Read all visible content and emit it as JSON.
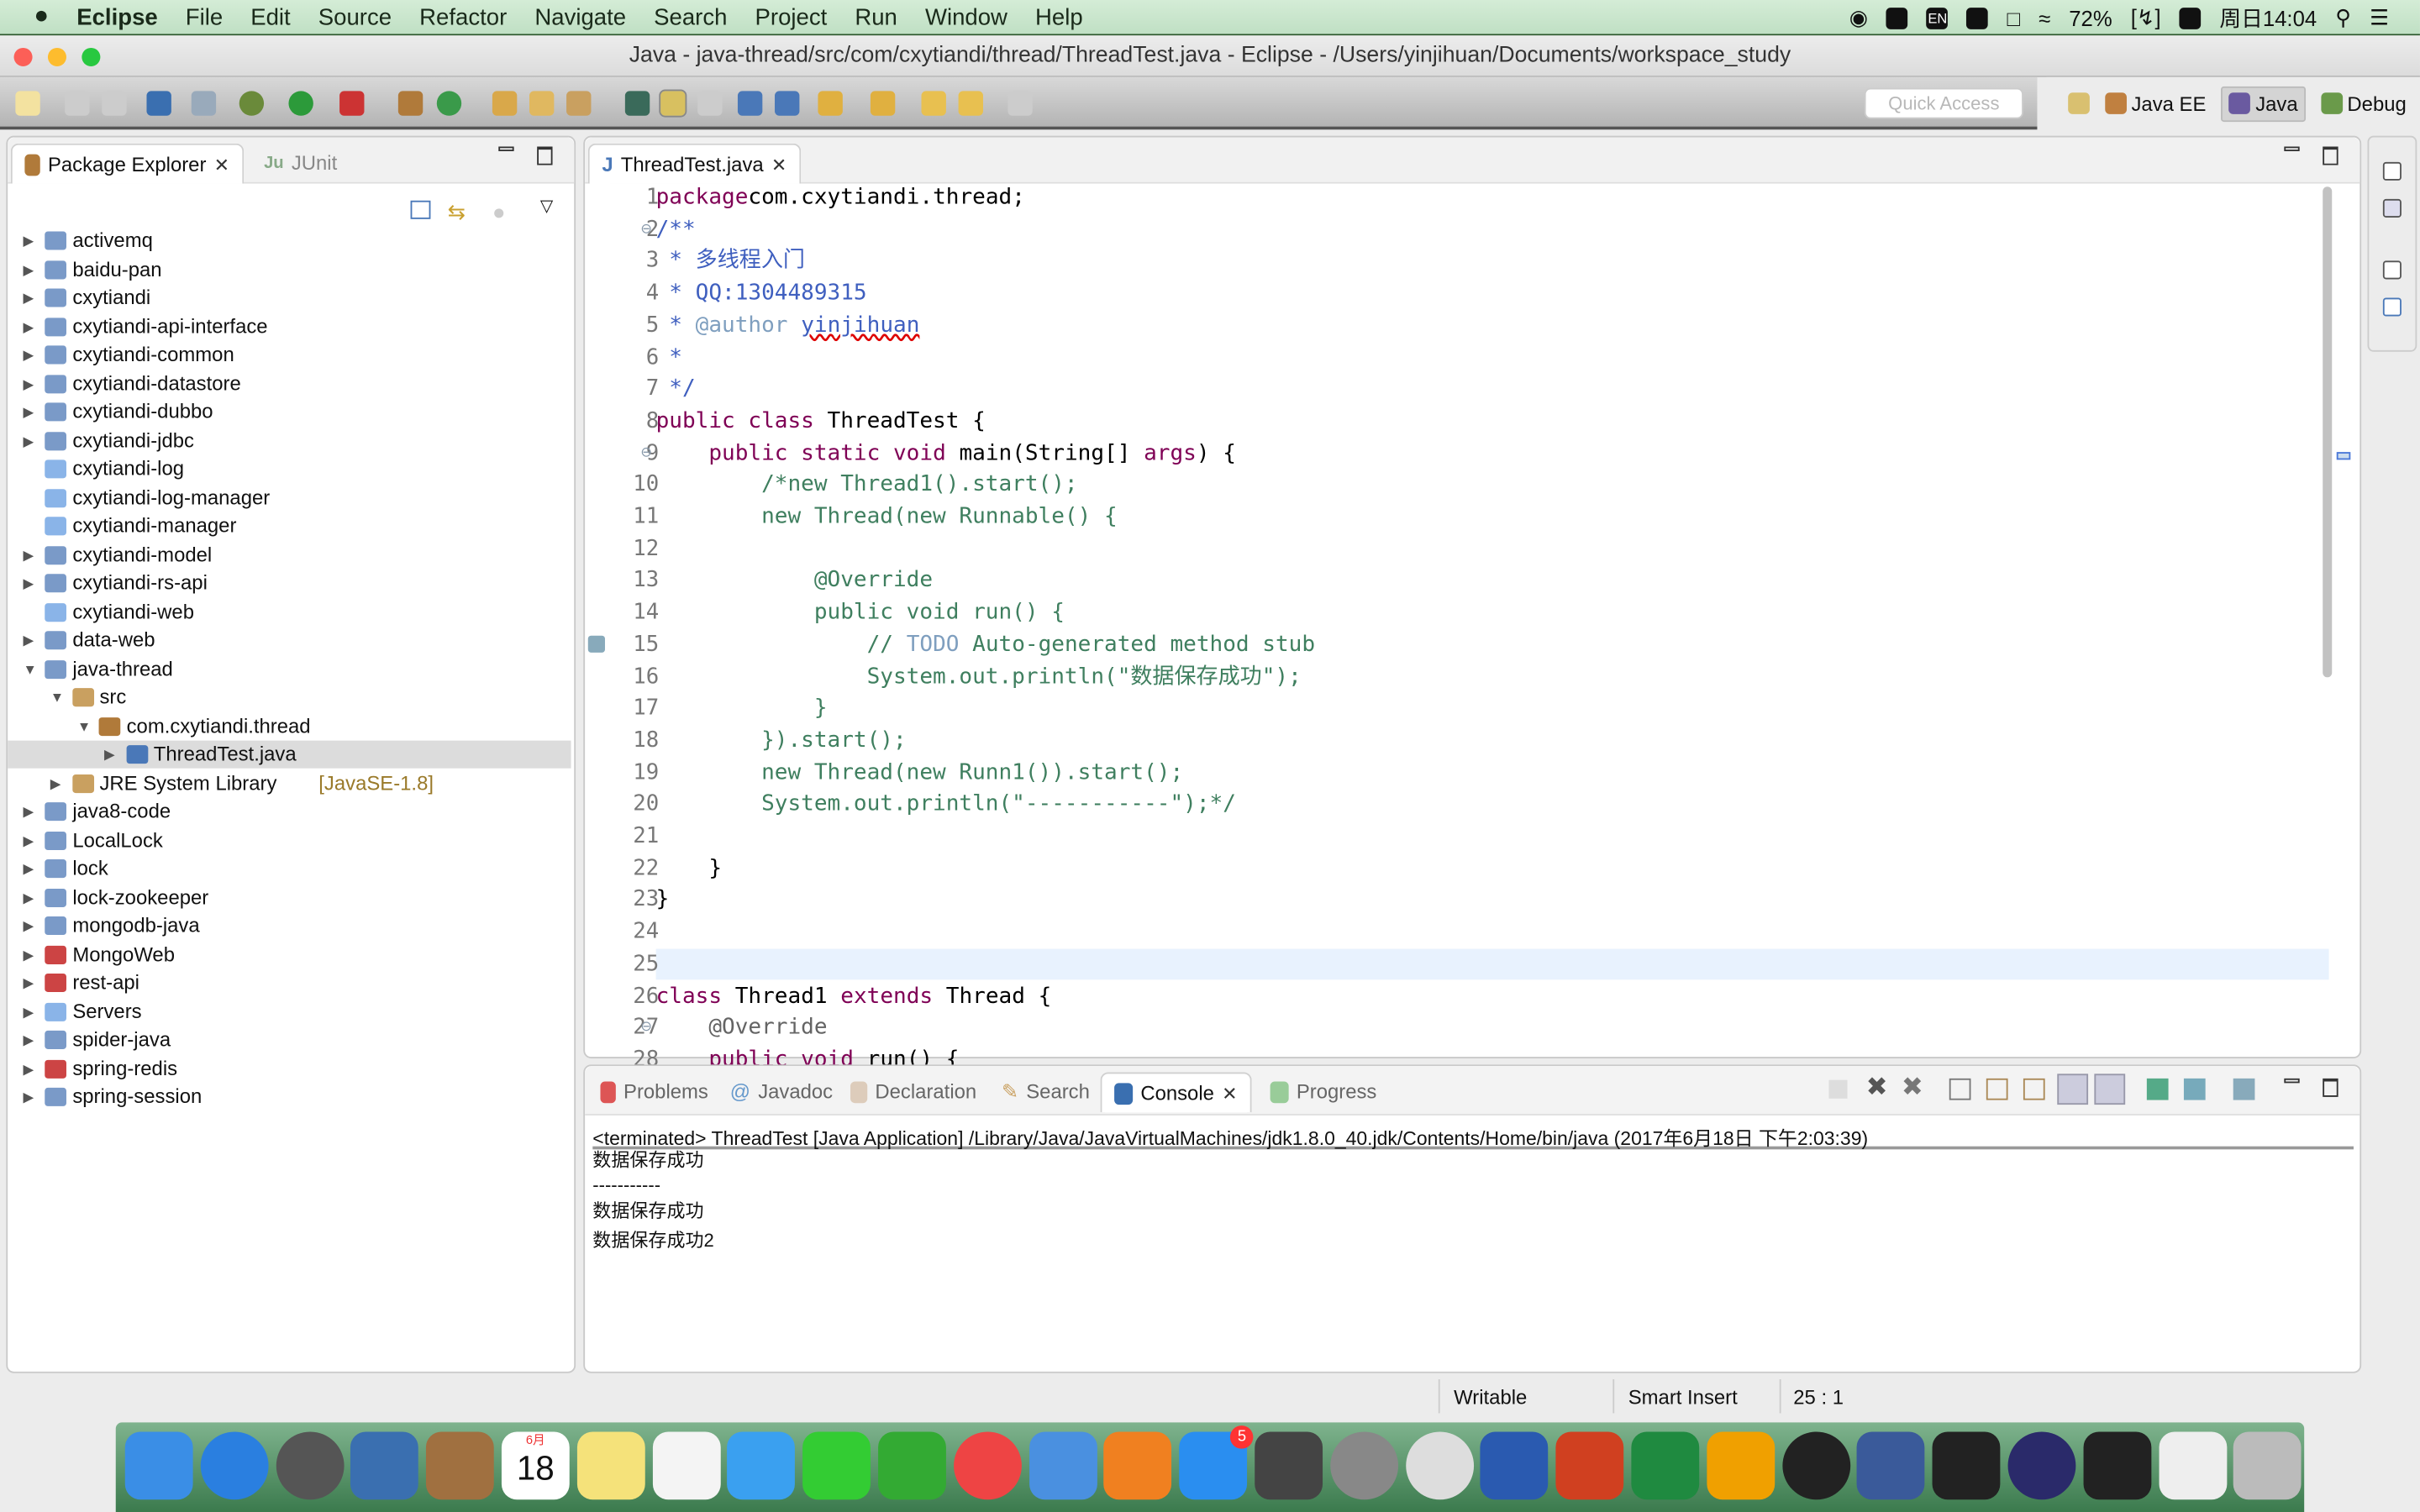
{
  "menubar": {
    "app": "Eclipse",
    "items": [
      "File",
      "Edit",
      "Source",
      "Refactor",
      "Navigate",
      "Search",
      "Project",
      "Run",
      "Window",
      "Help"
    ],
    "battery": "72%",
    "clock": "周日14:04",
    "input": "EN"
  },
  "window": {
    "title": "Java - java-thread/src/com/cxytiandi/thread/ThreadTest.java - Eclipse - /Users/yinjihuan/Documents/workspace_study"
  },
  "toolbar": {
    "quick_access_placeholder": "Quick Access",
    "perspectives": [
      {
        "label": "Java EE",
        "active": false
      },
      {
        "label": "Java",
        "active": true
      },
      {
        "label": "Debug",
        "active": false
      }
    ]
  },
  "explorer": {
    "tabs": [
      {
        "label": "Package Explorer",
        "active": true
      },
      {
        "label": "JUnit",
        "active": false
      }
    ],
    "items": [
      {
        "label": "activemq",
        "level": 0,
        "arrow": "right",
        "icon": "project"
      },
      {
        "label": "baidu-pan",
        "level": 0,
        "arrow": "right",
        "icon": "project"
      },
      {
        "label": "cxytiandi",
        "level": 0,
        "arrow": "right",
        "icon": "project"
      },
      {
        "label": "cxytiandi-api-interface",
        "level": 0,
        "arrow": "right",
        "icon": "project"
      },
      {
        "label": "cxytiandi-common",
        "level": 0,
        "arrow": "right",
        "icon": "project"
      },
      {
        "label": "cxytiandi-datastore",
        "level": 0,
        "arrow": "right",
        "icon": "project"
      },
      {
        "label": "cxytiandi-dubbo",
        "level": 0,
        "arrow": "right",
        "icon": "project"
      },
      {
        "label": "cxytiandi-jdbc",
        "level": 0,
        "arrow": "right",
        "icon": "project"
      },
      {
        "label": "cxytiandi-log",
        "level": 0,
        "arrow": "",
        "icon": "folder"
      },
      {
        "label": "cxytiandi-log-manager",
        "level": 0,
        "arrow": "",
        "icon": "folder"
      },
      {
        "label": "cxytiandi-manager",
        "level": 0,
        "arrow": "",
        "icon": "folder"
      },
      {
        "label": "cxytiandi-model",
        "level": 0,
        "arrow": "right",
        "icon": "project"
      },
      {
        "label": "cxytiandi-rs-api",
        "level": 0,
        "arrow": "right",
        "icon": "project"
      },
      {
        "label": "cxytiandi-web",
        "level": 0,
        "arrow": "",
        "icon": "folder"
      },
      {
        "label": "data-web",
        "level": 0,
        "arrow": "right",
        "icon": "project"
      },
      {
        "label": "java-thread",
        "level": 0,
        "arrow": "down",
        "icon": "project-open"
      },
      {
        "label": "src",
        "level": 1,
        "arrow": "down",
        "icon": "source-folder"
      },
      {
        "label": "com.cxytiandi.thread",
        "level": 2,
        "arrow": "down",
        "icon": "package"
      },
      {
        "label": "ThreadTest.java",
        "level": 3,
        "arrow": "right",
        "icon": "java-file",
        "selected": true
      },
      {
        "label": "JRE System Library",
        "decoration": "[JavaSE-1.8]",
        "level": 1,
        "arrow": "right",
        "icon": "library"
      },
      {
        "label": "java8-code",
        "level": 0,
        "arrow": "right",
        "icon": "project"
      },
      {
        "label": "LocalLock",
        "level": 0,
        "arrow": "right",
        "icon": "project"
      },
      {
        "label": "lock",
        "level": 0,
        "arrow": "right",
        "icon": "project"
      },
      {
        "label": "lock-zookeeper",
        "level": 0,
        "arrow": "right",
        "icon": "project"
      },
      {
        "label": "mongodb-java",
        "level": 0,
        "arrow": "right",
        "icon": "project"
      },
      {
        "label": "MongoWeb",
        "level": 0,
        "arrow": "right",
        "icon": "project-error"
      },
      {
        "label": "rest-api",
        "level": 0,
        "arrow": "right",
        "icon": "project-error"
      },
      {
        "label": "Servers",
        "level": 0,
        "arrow": "right",
        "icon": "folder-open"
      },
      {
        "label": "spider-java",
        "level": 0,
        "arrow": "right",
        "icon": "project"
      },
      {
        "label": "spring-redis",
        "level": 0,
        "arrow": "right",
        "icon": "project-error"
      },
      {
        "label": "spring-session",
        "level": 0,
        "arrow": "right",
        "icon": "project"
      }
    ]
  },
  "editor": {
    "tab": "ThreadTest.java",
    "current_line": 25,
    "lines": [
      [
        [
          "kw",
          "package"
        ],
        [
          "",
          "com.cxytiandi.thread;"
        ]
      ],
      [
        [
          "jd",
          "/**"
        ]
      ],
      [
        [
          "jd",
          " * 多线程入门"
        ]
      ],
      [
        [
          "jd",
          " * QQ:1304489315"
        ]
      ],
      [
        [
          "jd",
          " * "
        ],
        [
          "jt",
          "@author"
        ],
        [
          "jd",
          " "
        ],
        [
          "jd sp",
          "yinjihuan"
        ]
      ],
      [
        [
          "jd",
          " *"
        ]
      ],
      [
        [
          "jd",
          " */"
        ]
      ],
      [
        [
          "kw",
          "public class"
        ],
        [
          "",
          " ThreadTest {"
        ]
      ],
      [
        [
          "",
          "    "
        ],
        [
          "kw",
          "public static void"
        ],
        [
          "",
          " main(String[] "
        ],
        [
          "kw",
          "args"
        ],
        [
          "",
          ") {"
        ]
      ],
      [
        [
          "cm",
          "        /*new Thread1().start();"
        ]
      ],
      [
        [
          "cm",
          "        new Thread(new Runnable() {"
        ]
      ],
      [
        [
          "cm",
          ""
        ]
      ],
      [
        [
          "cm",
          "            @Override"
        ]
      ],
      [
        [
          "cm",
          "            public void run() {"
        ]
      ],
      [
        [
          "cm",
          "                // "
        ],
        [
          "todo",
          "TODO"
        ],
        [
          "cm",
          " Auto-generated method stub"
        ]
      ],
      [
        [
          "cm",
          "                System.out.println(\"数据保存成功\");"
        ]
      ],
      [
        [
          "cm",
          "            }"
        ]
      ],
      [
        [
          "cm",
          "        }).start();"
        ]
      ],
      [
        [
          "cm",
          "        new Thread(new Runn1()).start();"
        ]
      ],
      [
        [
          "cm",
          "        System.out.println(\"-----------\");*/"
        ]
      ],
      [
        [
          "",
          ""
        ]
      ],
      [
        [
          "",
          "    }"
        ]
      ],
      [
        [
          "",
          "}"
        ]
      ],
      [
        [
          "",
          ""
        ]
      ],
      [
        [
          "",
          ""
        ]
      ],
      [
        [
          "kw",
          "class"
        ],
        [
          "",
          " Thread1 "
        ],
        [
          "kw",
          "extends"
        ],
        [
          "",
          " Thread {"
        ]
      ],
      [
        [
          "an",
          "    @Override"
        ]
      ],
      [
        [
          "",
          "    "
        ],
        [
          "kw",
          "public void"
        ],
        [
          "",
          " run() {"
        ]
      ]
    ]
  },
  "bottom": {
    "tabs": [
      {
        "label": "Problems"
      },
      {
        "label": "Javadoc"
      },
      {
        "label": "Declaration"
      },
      {
        "label": "Search"
      },
      {
        "label": "Console",
        "active": true
      },
      {
        "label": "Progress"
      }
    ],
    "console_header": "<terminated> ThreadTest [Java Application] /Library/Java/JavaVirtualMachines/jdk1.8.0_40.jdk/Contents/Home/bin/java (2017年6月18日 下午2:03:39)",
    "output": [
      "数据保存成功",
      "-----------",
      "数据保存成功",
      "数据保存成功2"
    ]
  },
  "statusbar": {
    "mode": "Writable",
    "insert": "Smart Insert",
    "position": "25 : 1"
  },
  "dock": {
    "calendar_month": "6月",
    "calendar_day": "18",
    "app_store_badge": "5",
    "apps": [
      "finder-icon",
      "safari-icon",
      "launchpad-icon",
      "preview-icon",
      "contacts-icon",
      "calendar-icon",
      "notes-icon",
      "reminders-icon",
      "messages-icon",
      "facetime-icon",
      "numbers-icon",
      "itunes-icon",
      "keynote-icon",
      "ibooks-icon",
      "app-store-icon",
      "sublime-icon",
      "system-preferences-icon",
      "chrome-icon",
      "word-icon",
      "powerpoint-icon",
      "excel-icon",
      "outlook-icon",
      "qq-icon",
      "quicktime-icon",
      "terminal-icon",
      "eclipse-icon",
      "activity-monitor-icon",
      "documents-icon",
      "trash-icon"
    ],
    "colors": [
      "#3a8ee6",
      "#2a7fe0",
      "#555",
      "#3a6fb0",
      "#a07040",
      "#fff",
      "#f5e27a",
      "#f4f4f4",
      "#3aa0f0",
      "#3c3",
      "#3a3",
      "#e44",
      "#4a90e0",
      "#f08020",
      "#2a8ef0",
      "#444",
      "#888",
      "#ddd",
      "#2a5ab0",
      "#d04020",
      "#1f8a40",
      "#f0a000",
      "#222",
      "#3a5a9a",
      "#222",
      "#2a2a6a",
      "#222",
      "#eee",
      "#bbb"
    ]
  }
}
